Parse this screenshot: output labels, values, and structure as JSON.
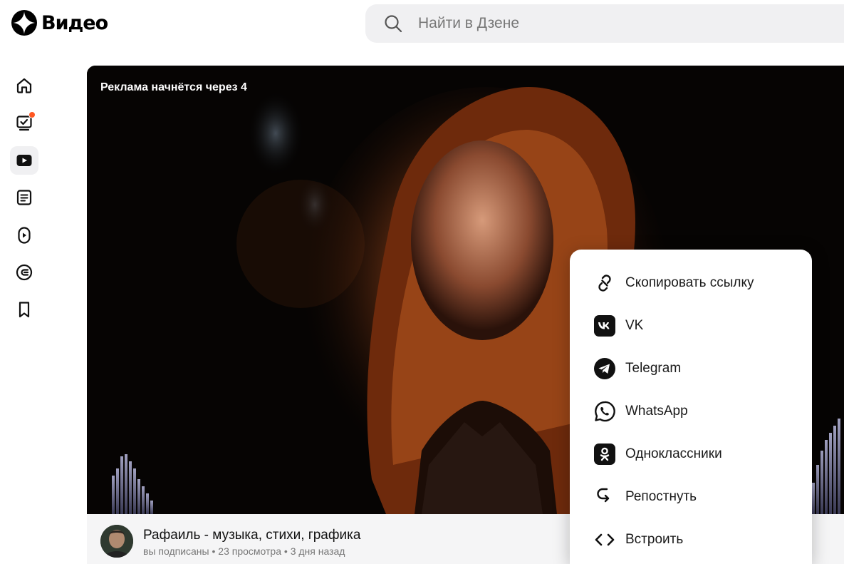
{
  "header": {
    "logo_text": "Видео",
    "logo_icon": "dzen-star-icon",
    "search_placeholder": "Найти в Дзене"
  },
  "sidebar": {
    "items": [
      {
        "icon": "home-icon",
        "active": false
      },
      {
        "icon": "subscriptions-icon",
        "active": false,
        "badge": true
      },
      {
        "icon": "video-icon",
        "active": true
      },
      {
        "icon": "articles-icon",
        "active": false
      },
      {
        "icon": "shorts-icon",
        "active": false
      },
      {
        "icon": "channels-icon",
        "active": false
      },
      {
        "icon": "bookmark-icon",
        "active": false
      }
    ]
  },
  "player": {
    "ad_label": "Реклама начнётся через 4"
  },
  "channel": {
    "name": "Рафаиль - музыка, стихи, графика",
    "subscription": "вы подписаны",
    "views": "23 просмотра",
    "age": "3 дня назад",
    "separator": " • "
  },
  "share_menu": {
    "items": [
      {
        "label": "Скопировать ссылку",
        "icon": "link-icon"
      },
      {
        "label": "VK",
        "icon": "vk-icon"
      },
      {
        "label": "Telegram",
        "icon": "telegram-icon"
      },
      {
        "label": "WhatsApp",
        "icon": "whatsapp-icon"
      },
      {
        "label": "Одноклассники",
        "icon": "odnoklassniki-icon"
      },
      {
        "label": "Репостнуть",
        "icon": "repost-icon"
      },
      {
        "label": "Встроить",
        "icon": "embed-icon"
      }
    ]
  },
  "colors": {
    "notification_dot": "#ff5722",
    "search_bg": "#f0f0f2",
    "channel_bar_bg": "#f5f5f6"
  }
}
